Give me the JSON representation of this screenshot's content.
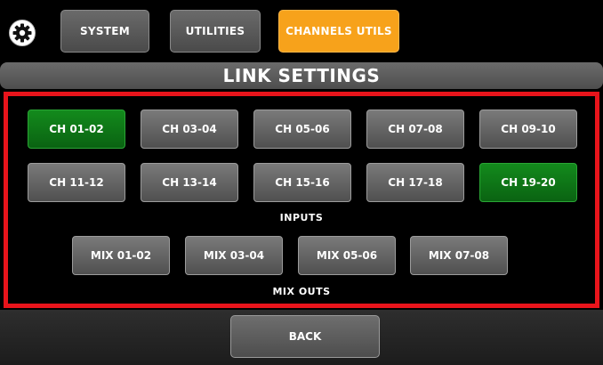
{
  "topbar": {
    "settings_icon": "gear-icon",
    "tabs": [
      {
        "label": "SYSTEM",
        "active": false
      },
      {
        "label": "UTILITIES",
        "active": false
      },
      {
        "label": "CHANNELS UTILS",
        "active": true
      }
    ]
  },
  "header": {
    "title": "LINK SETTINGS"
  },
  "inputs": {
    "label": "INPUTS",
    "channels": [
      {
        "label": "CH 01-02",
        "linked": true
      },
      {
        "label": "CH 03-04",
        "linked": false
      },
      {
        "label": "CH 05-06",
        "linked": false
      },
      {
        "label": "CH 07-08",
        "linked": false
      },
      {
        "label": "CH 09-10",
        "linked": false
      },
      {
        "label": "CH 11-12",
        "linked": false
      },
      {
        "label": "CH 13-14",
        "linked": false
      },
      {
        "label": "CH 15-16",
        "linked": false
      },
      {
        "label": "CH 17-18",
        "linked": false
      },
      {
        "label": "CH 19-20",
        "linked": true
      }
    ]
  },
  "mix_outs": {
    "label": "MIX OUTS",
    "channels": [
      {
        "label": "MIX 01-02",
        "linked": false
      },
      {
        "label": "MIX 03-04",
        "linked": false
      },
      {
        "label": "MIX 05-06",
        "linked": false
      },
      {
        "label": "MIX 07-08",
        "linked": false
      }
    ]
  },
  "footer": {
    "back_label": "BACK"
  },
  "colors": {
    "accent": "#f7a21b",
    "linked": "#138a1c",
    "highlight_border": "#e8141b"
  }
}
